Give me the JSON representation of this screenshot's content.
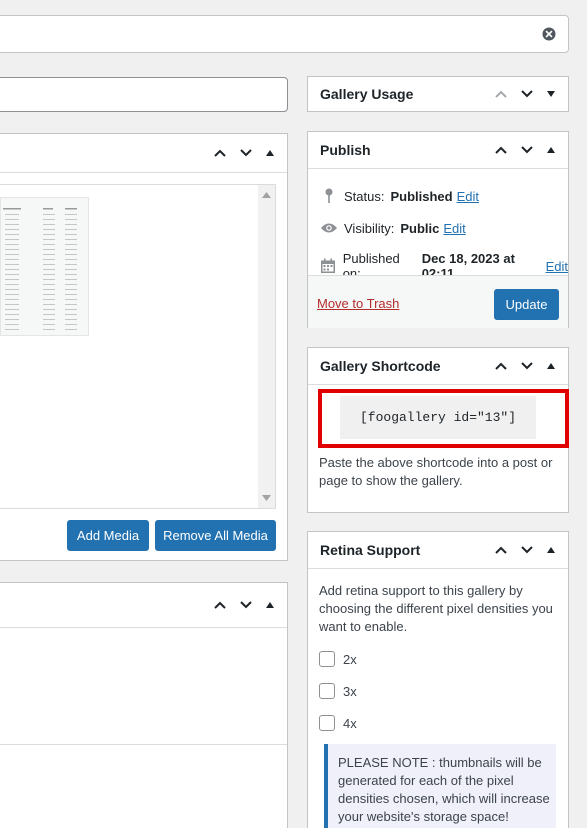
{
  "top_field": {
    "value": ""
  },
  "title_field": {
    "value": ""
  },
  "gallery_usage": {
    "title": "Gallery Usage"
  },
  "publish": {
    "title": "Publish",
    "status_label": "Status:",
    "status_value": "Published",
    "status_edit": "Edit",
    "visibility_label": "Visibility:",
    "visibility_value": "Public",
    "visibility_edit": "Edit",
    "published_label": "Published on:",
    "published_value": "Dec 18, 2023 at 02:11",
    "published_edit": "Edit",
    "trash": "Move to Trash",
    "update": "Update"
  },
  "media": {
    "add": "Add Media",
    "remove": "Remove All Media"
  },
  "shortcode": {
    "title": "Gallery Shortcode",
    "code": "[foogallery id=\"13\"]",
    "description": "Paste the above shortcode into a post or page to show the gallery."
  },
  "retina": {
    "title": "Retina Support",
    "description": "Add retina support to this gallery by choosing the different pixel densities you want to enable.",
    "options": [
      "2x",
      "3x",
      "4x"
    ],
    "note": "PLEASE NOTE : thumbnails will be generated for each of the pixel densities chosen, which will increase your website's storage space!"
  },
  "colors": {
    "primary": "#2271b1",
    "danger": "#b32d2e",
    "highlight": "#e00000"
  },
  "icons": {
    "clear": "x-circle-icon",
    "pin": "pin-icon",
    "eye": "eye-icon",
    "calendar": "calendar-icon",
    "up": "chevron-up-icon",
    "down": "chevron-down-icon",
    "toggle": "triangle-toggle-icon"
  }
}
